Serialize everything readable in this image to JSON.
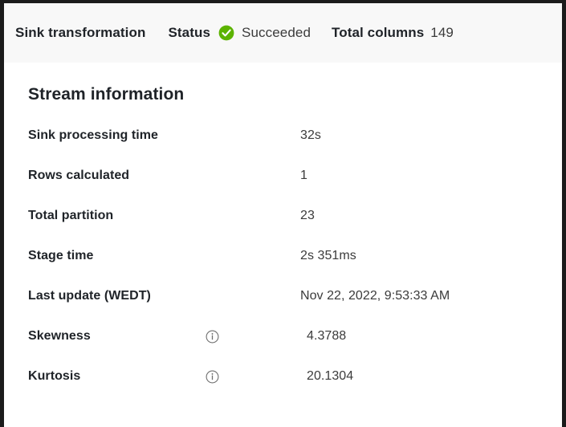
{
  "header": {
    "transformation_label": "Sink transformation",
    "status_label": "Status",
    "status_icon": "success-check-icon",
    "status_value": "Succeeded",
    "total_columns_label": "Total columns",
    "total_columns_value": "149",
    "success_color": "#5CB300",
    "band_background": "#F8F8F8"
  },
  "main": {
    "section_title": "Stream information",
    "rows": [
      {
        "label": "Sink processing time",
        "value": "32s",
        "icon": null
      },
      {
        "label": "Rows calculated",
        "value": "1",
        "icon": null
      },
      {
        "label": "Total partition",
        "value": "23",
        "icon": null
      },
      {
        "label": "Stage time",
        "value": "2s 351ms",
        "icon": null
      },
      {
        "label": "Last update (WEDT)",
        "value": "Nov 22, 2022, 9:53:33 AM",
        "icon": null
      },
      {
        "label": "Skewness",
        "value": "4.3788",
        "icon": "info-icon"
      },
      {
        "label": "Kurtosis",
        "value": "20.1304",
        "icon": "info-icon"
      }
    ]
  }
}
